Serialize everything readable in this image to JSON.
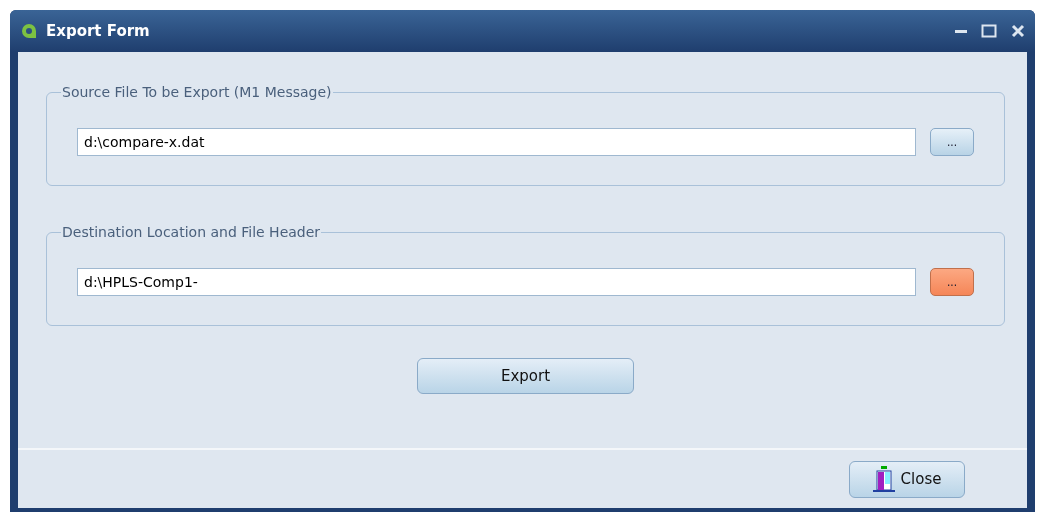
{
  "window": {
    "title": "Export Form"
  },
  "groups": [
    {
      "title": "Source File To be Export (M1 Message)",
      "value": "d:\\compare-x.dat",
      "browse": {
        "label": "...",
        "highlighted": false
      }
    },
    {
      "title": "Destination Location and File Header",
      "value": "d:\\HPLS-Comp1-",
      "browse": {
        "label": "...",
        "highlighted": true
      }
    }
  ],
  "export_button": "Export",
  "close_button": "Close"
}
